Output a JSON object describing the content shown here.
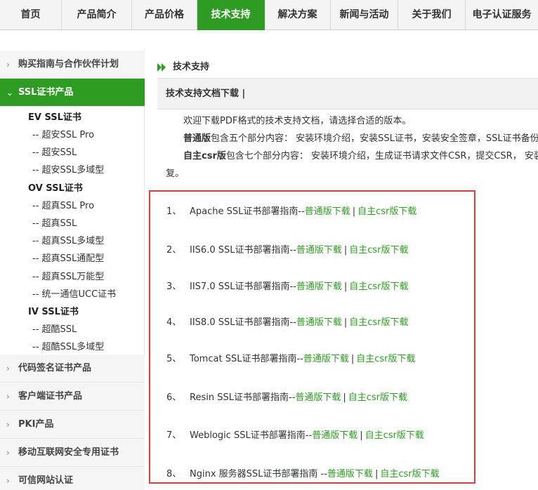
{
  "nav": {
    "items": [
      "首页",
      "产品简介",
      "产品价格",
      "技术支持",
      "解决方案",
      "新闻与活动",
      "关于我们",
      "电子认证服务"
    ],
    "active_index": 3
  },
  "sidebar": {
    "head_partner": "购买指南与合作伙伴计划",
    "head_ssl": "SSL证书产品",
    "ev": {
      "title": "EV SSL证书",
      "items": [
        "-- 超安SSL Pro",
        "-- 超安SSL",
        "-- 超安SSL多域型"
      ]
    },
    "ov": {
      "title": "OV SSL证书",
      "items": [
        "-- 超真SSL Pro",
        "-- 超真SSL",
        "-- 超真SSL多域型",
        "-- 超真SSL通配型",
        "-- 超真SSL万能型",
        "-- 统一通信UCC证书"
      ]
    },
    "iv": {
      "title": "IV SSL证书",
      "items": [
        "-- 超酷SSL",
        "-- 超酷SSL多域型"
      ]
    },
    "head_code": "代码签名证书产品",
    "head_client": "客户端证书产品",
    "head_pki": "PKI产品",
    "head_mobile": "移动互联网安全专用证书",
    "head_trusted": "可信网站认证"
  },
  "main": {
    "breadcrumb": "技术支持",
    "doc_title": "技术支持文档下载 |",
    "intro_line1": "欢迎下载PDF格式的技术支持文档，请选择合适的版本。",
    "intro_line2_bold": "普通版",
    "intro_line2_rest": "包含五个部分内容： 安装环境介绍，安装SSL证书，安装安全签章，SSL证书备份和",
    "intro_line3_bold": "自主csr版",
    "intro_line3_rest": "包含七个部分内容： 安装环境介绍，生成证书请求文件CSR，提交CSR， 安装S",
    "intro_line4": "复。",
    "separator": "|",
    "downloads": [
      {
        "num": "1、",
        "name": "Apache SSL证书部署指南--",
        "std": "普通版下载",
        "csr": "自主csr版下载"
      },
      {
        "num": "2、",
        "name": "IIS6.0 SSL证书部署指南--",
        "std": "普通版下载",
        "csr": "自主csr版下载"
      },
      {
        "num": "3、",
        "name": "IIS7.0 SSL证书部署指南--",
        "std": "普通版下载",
        "csr": "自主csr版下载"
      },
      {
        "num": "4、",
        "name": "IIS8.0 SSL证书部署指南--",
        "std": "普通版下载",
        "csr": "自主csr版下载"
      },
      {
        "num": "5、",
        "name": "Tomcat SSL证书部署指南--",
        "std": "普通版下载",
        "csr": "自主csr版下载"
      },
      {
        "num": "6、",
        "name": "Resin SSL证书部署指南--",
        "std": "普通版下载",
        "csr": "自主csr版下载"
      },
      {
        "num": "7、",
        "name": "Weblogic SSL证书部署指南--",
        "std": "普通版下载",
        "csr": "自主csr版下载"
      },
      {
        "num": "8、",
        "name": "Nginx 服务器SSL证书部署指南 --",
        "std": "普通版下载",
        "csr": "自主csr版下载"
      }
    ]
  },
  "colors": {
    "accent_green": "#2e9b22",
    "highlight_red": "#e53b3b"
  }
}
